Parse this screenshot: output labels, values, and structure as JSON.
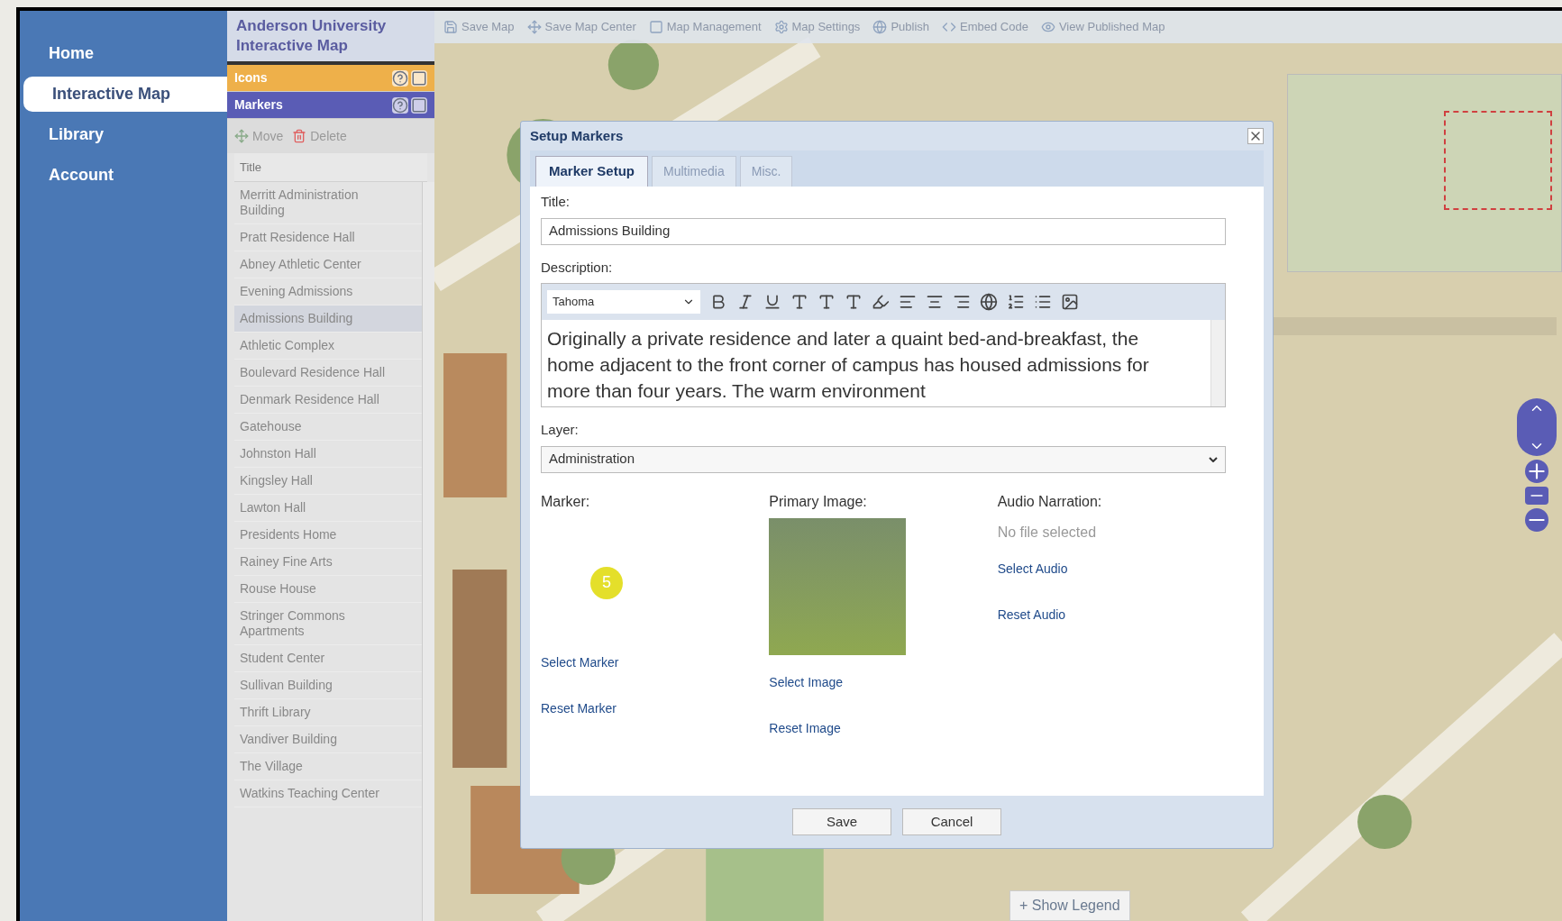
{
  "nav": [
    {
      "label": "Home",
      "selected": false
    },
    {
      "label": "Interactive Map",
      "selected": true
    },
    {
      "label": "Library",
      "selected": false
    },
    {
      "label": "Account",
      "selected": false
    }
  ],
  "sidebar": {
    "title": "Anderson University Interactive Map",
    "panels": [
      {
        "label": "Icons",
        "kind": "icons"
      },
      {
        "label": "Markers",
        "kind": "markers"
      }
    ],
    "actions": [
      {
        "label": "Move",
        "kind": "move"
      },
      {
        "label": "Delete",
        "kind": "delete"
      }
    ],
    "column": "Title",
    "items": [
      {
        "label": "Merritt Administration Building",
        "selected": false
      },
      {
        "label": "Pratt Residence Hall",
        "selected": false
      },
      {
        "label": "Abney Athletic Center",
        "selected": false
      },
      {
        "label": "Evening Admissions",
        "selected": false
      },
      {
        "label": "Admissions Building",
        "selected": true
      },
      {
        "label": "Athletic Complex",
        "selected": false
      },
      {
        "label": "Boulevard Residence Hall",
        "selected": false
      },
      {
        "label": "Denmark Residence Hall",
        "selected": false
      },
      {
        "label": "Gatehouse",
        "selected": false
      },
      {
        "label": "Johnston Hall",
        "selected": false
      },
      {
        "label": "Kingsley Hall",
        "selected": false
      },
      {
        "label": "Lawton Hall",
        "selected": false
      },
      {
        "label": "Presidents Home",
        "selected": false
      },
      {
        "label": "Rainey Fine Arts",
        "selected": false
      },
      {
        "label": "Rouse House",
        "selected": false
      },
      {
        "label": "Stringer Commons Apartments",
        "selected": false
      },
      {
        "label": "Student Center",
        "selected": false
      },
      {
        "label": "Sullivan Building",
        "selected": false
      },
      {
        "label": "Thrift Library",
        "selected": false
      },
      {
        "label": "Vandiver Building",
        "selected": false
      },
      {
        "label": "The Village",
        "selected": false
      },
      {
        "label": "Watkins Teaching Center",
        "selected": false
      }
    ]
  },
  "toolbar": [
    {
      "label": "Save Map",
      "kind": "save"
    },
    {
      "label": "Save Map Center",
      "kind": "center"
    },
    {
      "label": "Map Management",
      "kind": "manage"
    },
    {
      "label": "Map Settings",
      "kind": "settings"
    },
    {
      "label": "Publish",
      "kind": "publish"
    },
    {
      "label": "Embed Code",
      "kind": "embed"
    },
    {
      "label": "View Published Map",
      "kind": "view"
    }
  ],
  "dialog": {
    "title": "Setup Markers",
    "tabs": [
      {
        "label": "Marker Setup",
        "selected": true
      },
      {
        "label": "Multimedia",
        "selected": false
      },
      {
        "label": "Misc.",
        "selected": false
      }
    ],
    "title_label": "Title:",
    "title_value": "Admissions Building",
    "description_label": "Description:",
    "font": "Tahoma",
    "description": "Originally a private residence and later a quaint bed-and-breakfast, the home adjacent to the front corner of campus has housed admissions for more than four years. The warm environment",
    "layer_label": "Layer:",
    "layer_value": "Administration",
    "marker": {
      "label": "Marker:",
      "number": "5",
      "links": [
        "Select Marker",
        "Reset Marker"
      ]
    },
    "image": {
      "label": "Primary Image:",
      "links": [
        "Select Image",
        "Reset Image"
      ]
    },
    "audio": {
      "label": "Audio Narration:",
      "status": "No file selected",
      "links": [
        "Select Audio",
        "Reset Audio"
      ]
    },
    "buttons": [
      "Save",
      "Cancel"
    ]
  },
  "map": {
    "legend_button": "+ Show Legend"
  }
}
